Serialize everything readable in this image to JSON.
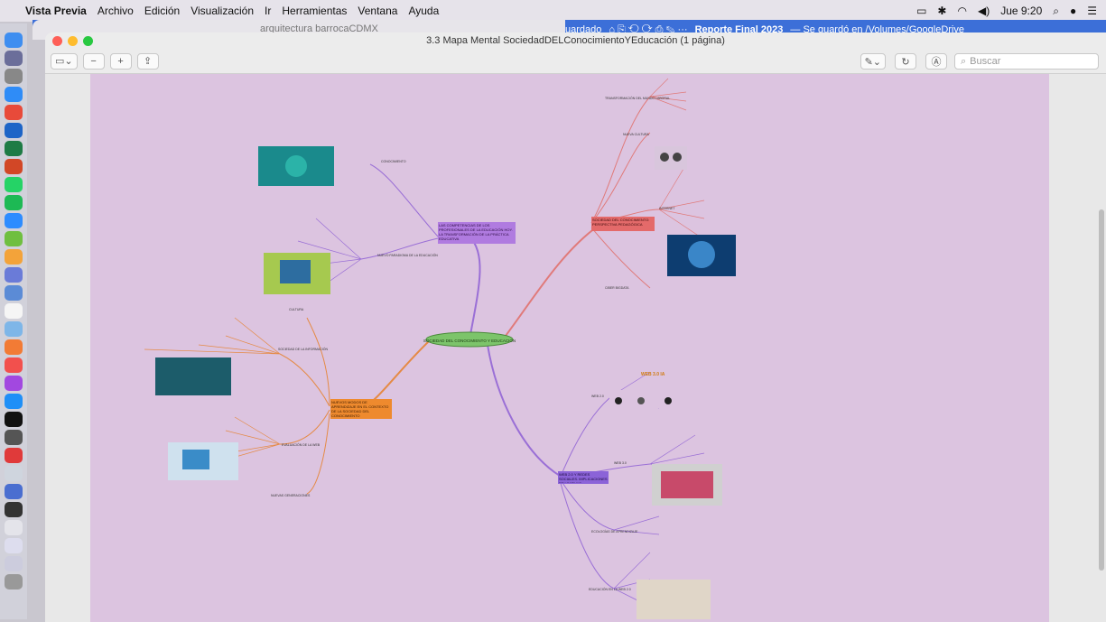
{
  "menubar": {
    "app_name": "Vista Previa",
    "items": [
      "Archivo",
      "Edición",
      "Visualización",
      "Ir",
      "Herramientas",
      "Ventana",
      "Ayuda"
    ],
    "clock": "Jue 9:20"
  },
  "background_window": {
    "title": "arquitectura barrocaCDMX",
    "status_left": "uardado",
    "doc_title": "Reporte Final 2023",
    "doc_status": "— Se guardó en /Volumes/GoogleDrive"
  },
  "window": {
    "title": "3.3 Mapa Mental SociedadDELConocimientoYEducación (1 página)",
    "search_placeholder": "Buscar"
  },
  "mindmap": {
    "center": "SOCIEDAD DEL CONOCIMIENTO Y EDUCACIÓN",
    "branches": {
      "competencias": "LAS COMPETENCIAS DE LOS PROFESIONALES DE LA EDUCACIÓN HOY. LA TRANSFORMACIÓN DE LA PRÁCTICA EDUCATIVA",
      "sociedad": "SOCIEDAD DEL CONOCIMIENTO: PERSPECTIVA PEDAGÓGICA",
      "nuevos": "NUEVOS MODOS DE APRENDIZAJE EN EL CONTEXTO DE LA SOCIEDAD DEL CONOCIMIENTO",
      "web": "WEB 2.0 Y REDES SOCIALES. IMPLICACIONES EDUCATIVAS"
    },
    "subs": {
      "conocimiento": "CONOCIMIENTO",
      "nuevo_paradigma": "NUEVO PARADIGMA DE LA EDUCACIÓN",
      "transformacion": "TRANSFORMACIÓN DEL MUNDO LABORAL",
      "nueva_cultura": "NUEVA CULTURA",
      "internet": "INTERNET",
      "ciber": "CIBER BIGDATA",
      "cultura": "CULTURA",
      "sociedad_info": "SOCIEDAD DE LA INFORMACIÓN",
      "evaluacion": "EVALUACIÓN DE LA WEB",
      "web_label": "WEB 2.0",
      "web3": "WEB 3.0",
      "ecologias": "ECOLOGÍAS DE APRENDIZAJE",
      "educacion": "EDUCACIÓN EN LA WEB 2.0",
      "ia": "WEB 3.0 IA",
      "nuevas_gen": "NUEVAS GENERACIONES"
    }
  }
}
